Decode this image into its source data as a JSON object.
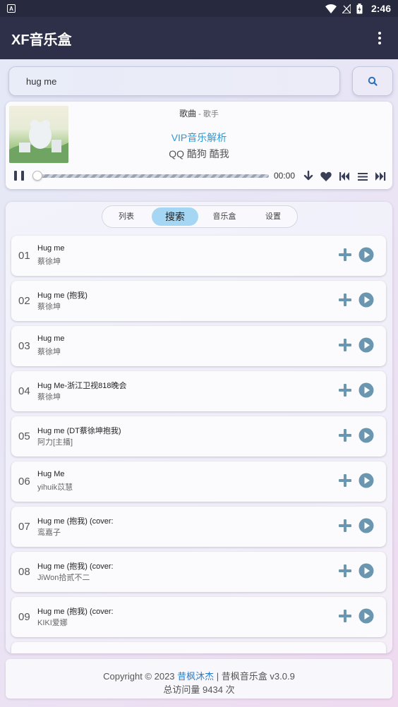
{
  "status_bar": {
    "time": "2:46",
    "notification_icon": "A"
  },
  "app_bar": {
    "title": "XF音乐盒",
    "menu_icon": "more-vert-icon"
  },
  "search": {
    "value": "hug me",
    "placeholder": "",
    "button_icon": "search-icon"
  },
  "player": {
    "song": "歌曲",
    "separator": " - ",
    "singer": "歌手",
    "vip_text": "VIP音乐解析",
    "sources_text": "QQ 酷狗 酷我",
    "time": "00:00",
    "progress": 0,
    "icons": [
      "pause-icon",
      "download-icon",
      "heart-icon",
      "skip-previous-icon",
      "playlist-icon",
      "skip-next-icon"
    ]
  },
  "tabs": [
    {
      "label": "列表",
      "active": false
    },
    {
      "label": "搜索",
      "active": true
    },
    {
      "label": "音乐盒",
      "active": false
    },
    {
      "label": "设置",
      "active": false
    }
  ],
  "results": [
    {
      "index": "01",
      "title": "Hug me",
      "artist": "蔡徐坤"
    },
    {
      "index": "02",
      "title": "Hug me (抱我)",
      "artist": "蔡徐坤"
    },
    {
      "index": "03",
      "title": "Hug me",
      "artist": "蔡徐坤"
    },
    {
      "index": "04",
      "title": "Hug Me-浙江卫视818晚会",
      "artist": "蔡徐坤"
    },
    {
      "index": "05",
      "title": "Hug me (DT蔡徐坤抱我)",
      "artist": "阿力[主播]"
    },
    {
      "index": "06",
      "title": "Hug Me",
      "artist": "yihuik苡慧"
    },
    {
      "index": "07",
      "title": "Hug me (抱我) (cover:",
      "artist": "鸾嘉子"
    },
    {
      "index": "08",
      "title": "Hug me (抱我) (cover:",
      "artist": "JiWon拾贰不二"
    },
    {
      "index": "09",
      "title": "Hug me (抱我) (cover:",
      "artist": "KIKI爱娜"
    }
  ],
  "footer": {
    "copyright_prefix": "Copyright © 2023 ",
    "author": "昔枫沐杰",
    "copyright_suffix": " | 昔枫音乐盒 v3.0.9",
    "visits": "总访问量 9434 次"
  },
  "colors": {
    "accent": "#2e9ad6",
    "icon": "#6a96b0",
    "app_bar": "#2d3048",
    "active_tab": "#a5d7f4"
  }
}
